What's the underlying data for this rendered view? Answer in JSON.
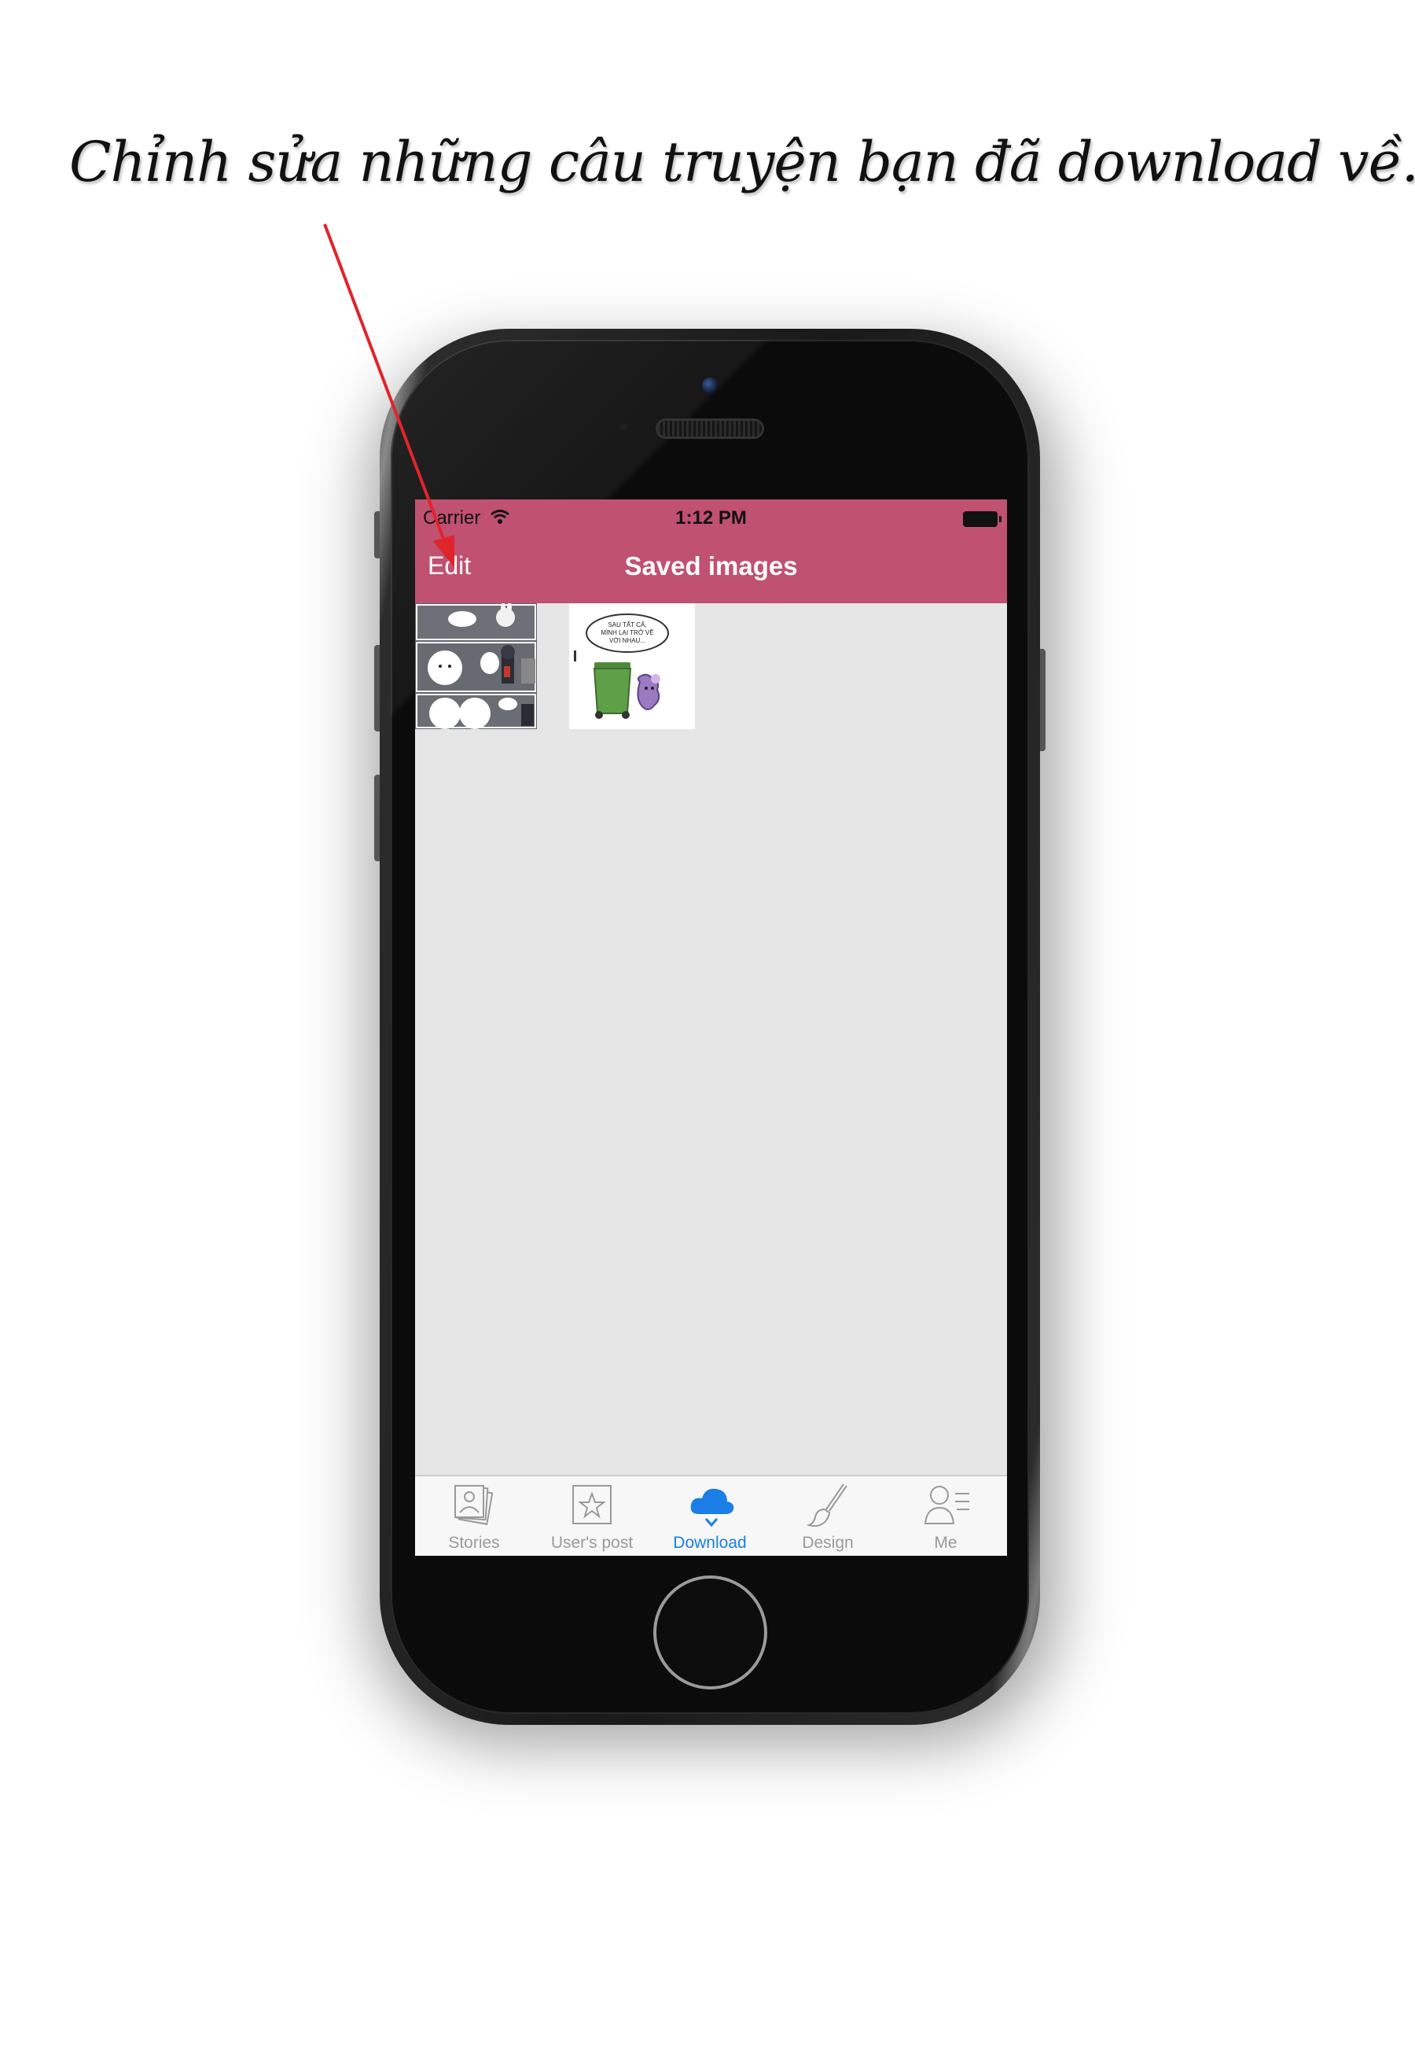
{
  "annotation": {
    "caption": "Chỉnh sửa những câu truyện bạn đã download về.",
    "arrow_color": "#e0242c"
  },
  "status_bar": {
    "carrier": "Carrier",
    "time": "1:12 PM"
  },
  "nav_bar": {
    "edit_label": "Edit",
    "title": "Saved images",
    "color": "#c05170"
  },
  "gallery": {
    "items": [
      {
        "name": "comic-1"
      },
      {
        "name": "comic-2",
        "bubble_text": "SAU TẤT CẢ, MÌNH LẠI TRỞ VỀ VỚI NHAU..."
      }
    ]
  },
  "tab_bar": {
    "active_color": "#1a7ee6",
    "inactive_color": "#9a9a9a",
    "tabs": [
      {
        "label": "Stories",
        "icon": "photos-stack-icon",
        "active": false
      },
      {
        "label": "User's post",
        "icon": "star-box-icon",
        "active": false
      },
      {
        "label": "Download",
        "icon": "cloud-download-icon",
        "active": true
      },
      {
        "label": "Design",
        "icon": "brush-icon",
        "active": false
      },
      {
        "label": "Me",
        "icon": "profile-list-icon",
        "active": false
      }
    ]
  }
}
